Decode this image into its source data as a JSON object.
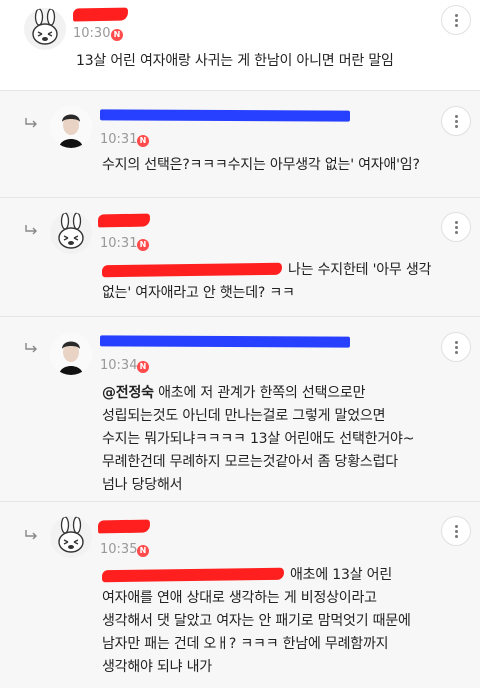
{
  "badge_label": "N",
  "comments": [
    {
      "author_avatar": "crying-rabbit-avatar",
      "time": "10:30",
      "text": "13살 어린 여자애랑 사귀는 게 한남이 아니면 머란 말임"
    },
    {
      "author_avatar": "person-photo-avatar",
      "time": "10:31",
      "text": "수지의 선택은?ㅋㅋㅋ수지는 아무생각 없는' 여자애'임?"
    },
    {
      "author_avatar": "crying-rabbit-avatar",
      "time": "10:31",
      "text_line1": "나는 수지한테 '아무 생각",
      "text_rest": "없는' 여자애라고 안 햇는데? ㅋㅋ"
    },
    {
      "author_avatar": "person-photo-avatar",
      "time": "10:34",
      "mention": "@전정숙",
      "text_line1": " 애초에 저 관계가 한쪽의 선택으로만",
      "text_rest": "성립되는것도 아닌데 만나는걸로 그렇게 말었으면\n수지는 뭐가되냐ㅋㅋㅋㅋ 13살 어린애도 선택한거야~\n무례한건데 무례하지 모르는것같아서 좀 당황스럽다\n넘나 당당해서"
    },
    {
      "author_avatar": "crying-rabbit-avatar",
      "time": "10:35",
      "text_line1": "애초에 13살 어린",
      "text_rest": "여자애를 연애 상대로 생각하는 게 비정상이라고\n생각해서 댓 달았고 여자는 안 패기로 맘먹엇기 때문에\n남자만 패는 건데 오ㅐ? ㅋㅋㅋ 한남에 무례함까지\n생각해야 되냐 내가"
    }
  ],
  "colors": {
    "redaction_red": "#ff1f1f",
    "redaction_blue": "#2740ff",
    "new_badge": "#ff4b4b",
    "reply_background": "#f7f7f7"
  }
}
